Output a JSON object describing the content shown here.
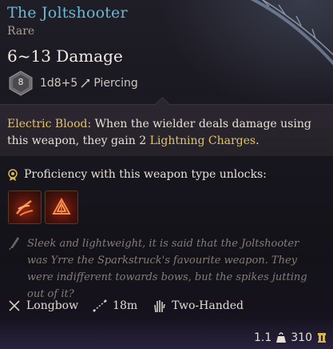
{
  "item": {
    "name": "The Joltshooter",
    "rarity": "Rare",
    "damage": "6~13 Damage",
    "die": "8",
    "damage_formula": "1d8+5",
    "damage_type": "Piercing"
  },
  "ability": {
    "name": "Electric Blood:",
    "text_before": " When the wielder deals damage using this weapon, they gain 2 ",
    "link": "Lightning Charges",
    "text_after": "."
  },
  "proficiency": {
    "label": "Proficiency with this weapon type unlocks:",
    "actions": [
      {
        "icon": "mobile-shot-icon"
      },
      {
        "icon": "hamstring-shot-icon"
      }
    ]
  },
  "lore": "Sleek and lightweight, it is said that the Joltshooter was Yrre the Sparkstruck's favourite weapon. They were indifferent towards bows, but the spikes jutting out of it?",
  "properties": {
    "weapon_type": "Longbow",
    "range": "18m",
    "handedness": "Two-Handed"
  },
  "footer": {
    "weight": "1.1",
    "value": "310"
  },
  "colors": {
    "title": "#6bb8d6",
    "ability_highlight": "#e3c36a",
    "lore_text": "#857d74"
  }
}
